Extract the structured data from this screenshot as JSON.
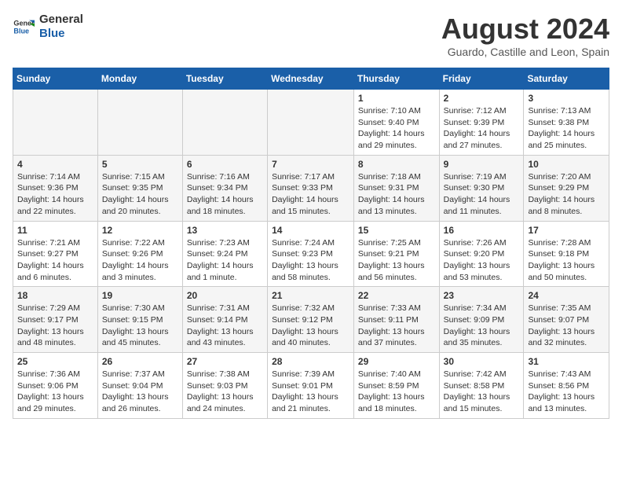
{
  "logo": {
    "general": "General",
    "blue": "Blue"
  },
  "title": "August 2024",
  "subtitle": "Guardo, Castille and Leon, Spain",
  "days_of_week": [
    "Sunday",
    "Monday",
    "Tuesday",
    "Wednesday",
    "Thursday",
    "Friday",
    "Saturday"
  ],
  "weeks": [
    [
      {
        "day": "",
        "text": ""
      },
      {
        "day": "",
        "text": ""
      },
      {
        "day": "",
        "text": ""
      },
      {
        "day": "",
        "text": ""
      },
      {
        "day": "1",
        "text": "Sunrise: 7:10 AM\nSunset: 9:40 PM\nDaylight: 14 hours and 29 minutes."
      },
      {
        "day": "2",
        "text": "Sunrise: 7:12 AM\nSunset: 9:39 PM\nDaylight: 14 hours and 27 minutes."
      },
      {
        "day": "3",
        "text": "Sunrise: 7:13 AM\nSunset: 9:38 PM\nDaylight: 14 hours and 25 minutes."
      }
    ],
    [
      {
        "day": "4",
        "text": "Sunrise: 7:14 AM\nSunset: 9:36 PM\nDaylight: 14 hours and 22 minutes."
      },
      {
        "day": "5",
        "text": "Sunrise: 7:15 AM\nSunset: 9:35 PM\nDaylight: 14 hours and 20 minutes."
      },
      {
        "day": "6",
        "text": "Sunrise: 7:16 AM\nSunset: 9:34 PM\nDaylight: 14 hours and 18 minutes."
      },
      {
        "day": "7",
        "text": "Sunrise: 7:17 AM\nSunset: 9:33 PM\nDaylight: 14 hours and 15 minutes."
      },
      {
        "day": "8",
        "text": "Sunrise: 7:18 AM\nSunset: 9:31 PM\nDaylight: 14 hours and 13 minutes."
      },
      {
        "day": "9",
        "text": "Sunrise: 7:19 AM\nSunset: 9:30 PM\nDaylight: 14 hours and 11 minutes."
      },
      {
        "day": "10",
        "text": "Sunrise: 7:20 AM\nSunset: 9:29 PM\nDaylight: 14 hours and 8 minutes."
      }
    ],
    [
      {
        "day": "11",
        "text": "Sunrise: 7:21 AM\nSunset: 9:27 PM\nDaylight: 14 hours and 6 minutes."
      },
      {
        "day": "12",
        "text": "Sunrise: 7:22 AM\nSunset: 9:26 PM\nDaylight: 14 hours and 3 minutes."
      },
      {
        "day": "13",
        "text": "Sunrise: 7:23 AM\nSunset: 9:24 PM\nDaylight: 14 hours and 1 minute."
      },
      {
        "day": "14",
        "text": "Sunrise: 7:24 AM\nSunset: 9:23 PM\nDaylight: 13 hours and 58 minutes."
      },
      {
        "day": "15",
        "text": "Sunrise: 7:25 AM\nSunset: 9:21 PM\nDaylight: 13 hours and 56 minutes."
      },
      {
        "day": "16",
        "text": "Sunrise: 7:26 AM\nSunset: 9:20 PM\nDaylight: 13 hours and 53 minutes."
      },
      {
        "day": "17",
        "text": "Sunrise: 7:28 AM\nSunset: 9:18 PM\nDaylight: 13 hours and 50 minutes."
      }
    ],
    [
      {
        "day": "18",
        "text": "Sunrise: 7:29 AM\nSunset: 9:17 PM\nDaylight: 13 hours and 48 minutes."
      },
      {
        "day": "19",
        "text": "Sunrise: 7:30 AM\nSunset: 9:15 PM\nDaylight: 13 hours and 45 minutes."
      },
      {
        "day": "20",
        "text": "Sunrise: 7:31 AM\nSunset: 9:14 PM\nDaylight: 13 hours and 43 minutes."
      },
      {
        "day": "21",
        "text": "Sunrise: 7:32 AM\nSunset: 9:12 PM\nDaylight: 13 hours and 40 minutes."
      },
      {
        "day": "22",
        "text": "Sunrise: 7:33 AM\nSunset: 9:11 PM\nDaylight: 13 hours and 37 minutes."
      },
      {
        "day": "23",
        "text": "Sunrise: 7:34 AM\nSunset: 9:09 PM\nDaylight: 13 hours and 35 minutes."
      },
      {
        "day": "24",
        "text": "Sunrise: 7:35 AM\nSunset: 9:07 PM\nDaylight: 13 hours and 32 minutes."
      }
    ],
    [
      {
        "day": "25",
        "text": "Sunrise: 7:36 AM\nSunset: 9:06 PM\nDaylight: 13 hours and 29 minutes."
      },
      {
        "day": "26",
        "text": "Sunrise: 7:37 AM\nSunset: 9:04 PM\nDaylight: 13 hours and 26 minutes."
      },
      {
        "day": "27",
        "text": "Sunrise: 7:38 AM\nSunset: 9:03 PM\nDaylight: 13 hours and 24 minutes."
      },
      {
        "day": "28",
        "text": "Sunrise: 7:39 AM\nSunset: 9:01 PM\nDaylight: 13 hours and 21 minutes."
      },
      {
        "day": "29",
        "text": "Sunrise: 7:40 AM\nSunset: 8:59 PM\nDaylight: 13 hours and 18 minutes."
      },
      {
        "day": "30",
        "text": "Sunrise: 7:42 AM\nSunset: 8:58 PM\nDaylight: 13 hours and 15 minutes."
      },
      {
        "day": "31",
        "text": "Sunrise: 7:43 AM\nSunset: 8:56 PM\nDaylight: 13 hours and 13 minutes."
      }
    ]
  ],
  "colors": {
    "header_bg": "#1a5fa8",
    "header_text": "#ffffff",
    "odd_row_bg": "#f5f5f5",
    "even_row_bg": "#ffffff"
  }
}
